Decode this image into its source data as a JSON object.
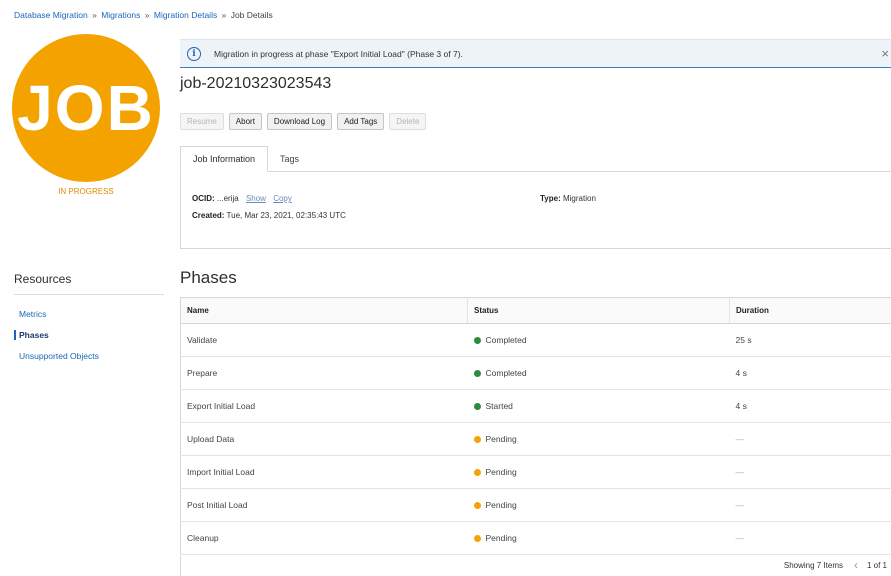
{
  "breadcrumb": {
    "items": [
      "Database Migration",
      "Migrations",
      "Migration Details"
    ],
    "current": "Job Details",
    "separator": "»"
  },
  "job_badge": {
    "text": "JOB",
    "status": "IN PROGRESS",
    "color": "#f4a200"
  },
  "banner": {
    "icon": "info-icon",
    "message": "Migration in progress at phase \"Export Initial Load\" (Phase 3 of 7).",
    "close": "×"
  },
  "title": "job-20210323023543",
  "actions": [
    {
      "label": "Resume",
      "disabled": true
    },
    {
      "label": "Abort",
      "disabled": false
    },
    {
      "label": "Download Log",
      "disabled": false
    },
    {
      "label": "Add Tags",
      "disabled": false
    },
    {
      "label": "Delete",
      "disabled": true
    }
  ],
  "tabs": [
    {
      "label": "Job Information",
      "active": true
    },
    {
      "label": "Tags",
      "active": false
    }
  ],
  "job_info": {
    "ocid_label": "OCID:",
    "ocid_value": "...erija",
    "show_link": "Show",
    "copy_link": "Copy",
    "created_label": "Created:",
    "created_value": "Tue, Mar 23, 2021, 02:35:43 UTC",
    "type_label": "Type:",
    "type_value": "Migration"
  },
  "resources": {
    "title": "Resources",
    "items": [
      {
        "label": "Metrics",
        "active": false
      },
      {
        "label": "Phases",
        "active": true
      },
      {
        "label": "Unsupported Objects",
        "active": false
      }
    ]
  },
  "phases": {
    "title": "Phases",
    "columns": [
      "Name",
      "Status",
      "Duration"
    ],
    "rows": [
      {
        "name": "Validate",
        "status": "Completed",
        "color": "green",
        "duration": "25 s"
      },
      {
        "name": "Prepare",
        "status": "Completed",
        "color": "green",
        "duration": "4 s"
      },
      {
        "name": "Export Initial Load",
        "status": "Started",
        "color": "green",
        "duration": "4 s"
      },
      {
        "name": "Upload Data",
        "status": "Pending",
        "color": "orange",
        "duration": "—"
      },
      {
        "name": "Import Initial Load",
        "status": "Pending",
        "color": "orange",
        "duration": "—"
      },
      {
        "name": "Post Initial Load",
        "status": "Pending",
        "color": "orange",
        "duration": "—"
      },
      {
        "name": "Cleanup",
        "status": "Pending",
        "color": "orange",
        "duration": "—"
      }
    ]
  },
  "pagination": {
    "showing": "Showing 7 Items",
    "page": "1 of 1"
  }
}
